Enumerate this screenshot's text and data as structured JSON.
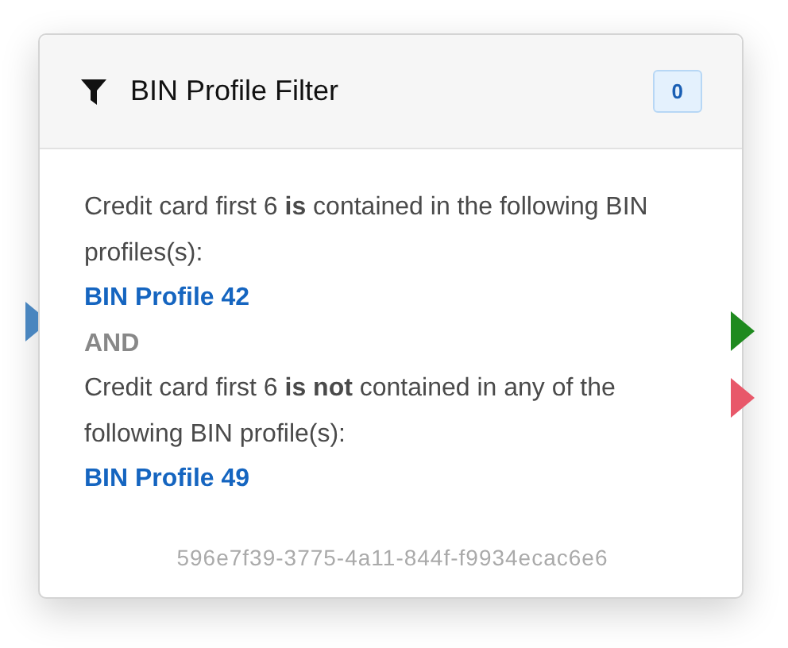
{
  "node": {
    "title": "BIN Profile Filter",
    "count": "0",
    "body": [
      {
        "kind": "sentence",
        "text": "Credit card first 6 **is** contained in the following BIN profiles(s):"
      },
      {
        "kind": "link",
        "text": "BIN Profile 42"
      },
      {
        "kind": "operator",
        "text": "AND"
      },
      {
        "kind": "sentence",
        "text": "Credit card first 6 **is not** contained in any of the following BIN profile(s):"
      },
      {
        "kind": "link",
        "text": "BIN Profile 49"
      }
    ],
    "id": "596e7f39-3775-4a11-844f-f9934ecac6e6",
    "ports": [
      {
        "kind": "input",
        "color": "#4a86bf"
      },
      {
        "kind": "output",
        "color": "#1f8a1f"
      },
      {
        "kind": "output",
        "color": "#e8586a"
      }
    ]
  }
}
